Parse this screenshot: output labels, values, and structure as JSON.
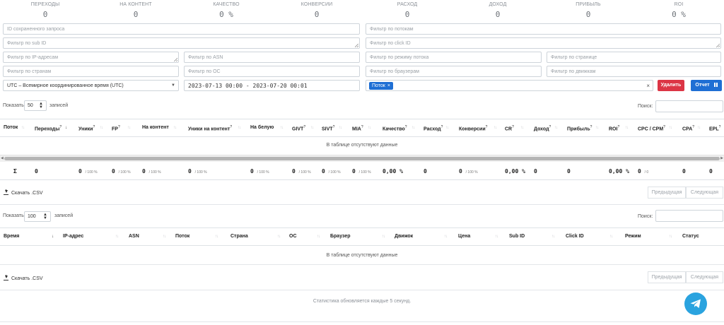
{
  "stats": [
    {
      "label": "ПЕРЕХОДЫ",
      "value": "0"
    },
    {
      "label": "НА КОНТЕНТ",
      "value": "0"
    },
    {
      "label": "КАЧЕСТВО",
      "value": "0 %"
    },
    {
      "label": "КОНВЕРСИИ",
      "value": "0"
    },
    {
      "label": "РАСХОД",
      "value": "0"
    },
    {
      "label": "ДОХОД",
      "value": "0"
    },
    {
      "label": "ПРИБЫЛЬ",
      "value": "0"
    },
    {
      "label": "ROI",
      "value": "0 %"
    }
  ],
  "filters": {
    "saved_query": "ID сохраненного запроса",
    "streams": "Фильтр по потокам",
    "sub_id": "Фильтр по sub ID",
    "click_id": "Фильтр по click ID",
    "ip": "Фильтр по IP-адресам",
    "asn": "Фильтр по ASN",
    "stream_mode": "Фильтр по режиму потока",
    "page": "Фильтр по странице",
    "countries": "Фильтр по странам",
    "os": "Фильтр по ОС",
    "browsers": "Фильтр по браузерам",
    "engines": "Фильтр по движкам",
    "timezone": "UTC – Всемирное координированное время (UTC)",
    "date_range": "2023-07-13 00:00 - 2023-07-20 00:01",
    "group_tag": "Поток",
    "delete_btn": "Удалить",
    "report_btn": "Отчет"
  },
  "table1": {
    "show_label": "Показать",
    "entries_label": "записей",
    "length": "50",
    "search_label": "Поиск:",
    "columns": [
      "Поток",
      "Переходы",
      "Уники",
      "FP",
      "На контент",
      "Уники на контент",
      "На белую",
      "GIVT",
      "SIVT",
      "MIA",
      "Качество",
      "Расход",
      "Конверсии",
      "CR",
      "Доход",
      "Прибыль",
      "ROI",
      "CPC / CPM",
      "CPA",
      "EPL"
    ],
    "empty": "В таблице отсутствуют данные",
    "sum_symbol": "Σ",
    "sum_values": [
      "0",
      "0",
      "/ 100 %",
      "0",
      "/ 100 %",
      "0",
      "/ 100 %",
      "0",
      "/ 100 %",
      "0",
      "/ 100 %",
      "0",
      "/ 100 %",
      "0",
      "/ 100 %",
      "0",
      "/ 100 %",
      "0,00 %",
      "0",
      "0",
      "/ 100 %",
      "0,00 %",
      "0",
      "0",
      "0,00 %",
      "0",
      "/ 0",
      "0",
      "0"
    ],
    "download": "Скачать .CSV",
    "prev": "Предыдущая",
    "next": "Следующая"
  },
  "table2": {
    "show_label": "Показать",
    "entries_label": "записей",
    "length": "100",
    "search_label": "Поиск:",
    "columns": [
      "Время",
      "IP-адрес",
      "ASN",
      "Поток",
      "Страна",
      "ОС",
      "Браузер",
      "Движок",
      "Цена",
      "Sub ID",
      "Click ID",
      "Режим",
      "Статус"
    ],
    "empty": "В таблице отсутствуют данные",
    "download": "Скачать .CSV",
    "prev": "Предыдущая",
    "next": "Следующая"
  },
  "footer_note": "Статистика обновляется каждые 5 секунд.",
  "colors": {
    "accent": "#1f6fd4",
    "danger": "#dc3545",
    "telegram": "#2aa3df"
  }
}
